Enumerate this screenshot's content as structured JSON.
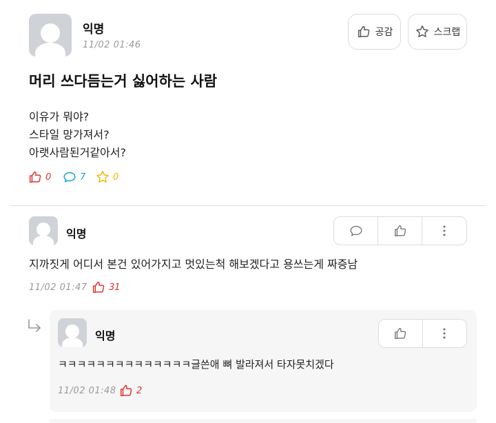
{
  "post": {
    "author": "익명",
    "time": "11/02 01:46",
    "empathy_label": "공감",
    "scrap_label": "스크랩",
    "title": "머리 쓰다듬는거 싫어하는 사람",
    "body_lines": [
      "이유가 뭐야?",
      "스타일 망가져서?",
      "아랫사람된거같아서?"
    ],
    "vote_count": "0",
    "comment_count": "7",
    "scrap_count": "0"
  },
  "comment": {
    "author": "익명",
    "text": "지까짓게 어디서 본건 있어가지고 멋있는척 해보겠다고 용쓰는게 짜증남",
    "time": "11/02 01:47",
    "vote_count": "31"
  },
  "reply": {
    "author": "익명",
    "text": "ㅋㅋㅋㅋㅋㅋㅋㅋㅋㅋㅋㅋㅋㅋ글쓴애 뼈 발라져서 타자못치겠다",
    "time": "11/02 01:48",
    "vote_count": "2"
  },
  "colors": {
    "vote_red": "#e0322d",
    "comment_blue": "#0aa3c9",
    "scrap_yellow": "#f2b600",
    "avatar_gray": "#cfd3d8"
  },
  "icons": [
    "thumbs-up-icon",
    "star-icon",
    "speech-bubble-icon",
    "more-vertical-icon",
    "reply-arrow-icon"
  ]
}
